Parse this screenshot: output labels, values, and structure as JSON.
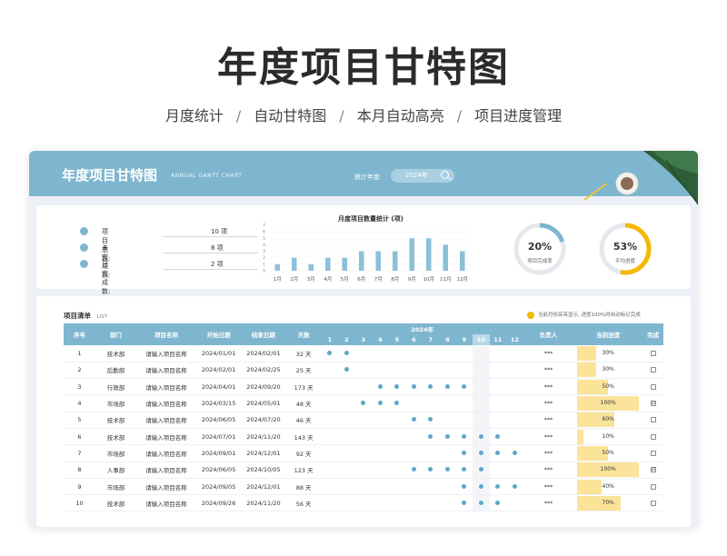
{
  "hero": {
    "title": "年度项目甘特图",
    "subtitles": [
      "月度统计",
      "自动甘特图",
      "本月自动高亮",
      "项目进度管理"
    ],
    "separator": "/"
  },
  "banner": {
    "title": "年度项目甘特图",
    "subtitle_en": "ANNUAL GANTT CHART",
    "year_label": "统计年度",
    "year_value": "2024年"
  },
  "stats": [
    {
      "label": "项目总数:",
      "value": "10 项",
      "icon": "folder-icon"
    },
    {
      "label": "未完成数:",
      "value": "8 项",
      "icon": "clock-icon"
    },
    {
      "label": "已完成数:",
      "value": "2 项",
      "icon": "check-icon"
    }
  ],
  "mini_chart": {
    "title": "月度项目数量统计 (项)"
  },
  "chart_data": {
    "type": "bar",
    "title": "月度项目数量统计 (项)",
    "categories": [
      "1月",
      "2月",
      "3月",
      "4月",
      "5月",
      "6月",
      "7月",
      "8月",
      "9月",
      "10月",
      "11月",
      "12月"
    ],
    "values": [
      1,
      2,
      1,
      2,
      2,
      3,
      3,
      3,
      5,
      5,
      4,
      3
    ],
    "ylim": [
      0,
      7
    ],
    "yticks": [
      "0",
      "1",
      "2",
      "3",
      "4",
      "5",
      "6",
      "7"
    ],
    "color": "#8cc0d8"
  },
  "rings": [
    {
      "pct": "20%",
      "value": 0.2,
      "label": "项目完成率",
      "color": "#7fb6cf"
    },
    {
      "pct": "53%",
      "value": 0.53,
      "label": "平均进度",
      "color": "#f5b800"
    }
  ],
  "list": {
    "title": "项目清单",
    "title_en": "LIST",
    "note": "当前月份高亮显示, 进度100%时自动标记完成",
    "note_color": "#f5b800"
  },
  "table": {
    "headers": [
      "序号",
      "部门",
      "项目名称",
      "开始日期",
      "结束日期",
      "天数"
    ],
    "year_header": "2024年",
    "months": [
      "1",
      "2",
      "3",
      "4",
      "5",
      "6",
      "7",
      "8",
      "9",
      "10",
      "11",
      "12"
    ],
    "current_month": 10,
    "owner_header": "负责人",
    "progress_header": "当前进度",
    "done_header": "完成",
    "rows": [
      {
        "no": "1",
        "dept": "技术部",
        "name": "请输入项目名称",
        "start": "2024/01/01",
        "end": "2024/02/01",
        "days": "32 天",
        "active": [
          1,
          2
        ],
        "owner": "***",
        "progress": "30%",
        "pval": 0.3,
        "done": ""
      },
      {
        "no": "2",
        "dept": "后勤部",
        "name": "请输入项目名称",
        "start": "2024/02/01",
        "end": "2024/02/25",
        "days": "25 天",
        "active": [
          2
        ],
        "owner": "***",
        "progress": "30%",
        "pval": 0.3,
        "done": ""
      },
      {
        "no": "3",
        "dept": "行政部",
        "name": "请输入项目名称",
        "start": "2024/04/01",
        "end": "2024/09/20",
        "days": "173 天",
        "active": [
          4,
          5,
          6,
          7,
          8,
          9
        ],
        "owner": "***",
        "progress": "50%",
        "pval": 0.5,
        "done": ""
      },
      {
        "no": "4",
        "dept": "市场部",
        "name": "请输入项目名称",
        "start": "2024/03/15",
        "end": "2024/05/01",
        "days": "48 天",
        "active": [
          3,
          4,
          5
        ],
        "owner": "***",
        "progress": "100%",
        "pval": 1.0,
        "done": "☑"
      },
      {
        "no": "5",
        "dept": "技术部",
        "name": "请输入项目名称",
        "start": "2024/06/05",
        "end": "2024/07/20",
        "days": "46 天",
        "active": [
          6,
          7
        ],
        "owner": "***",
        "progress": "60%",
        "pval": 0.6,
        "done": ""
      },
      {
        "no": "6",
        "dept": "技术部",
        "name": "请输入项目名称",
        "start": "2024/07/01",
        "end": "2024/11/20",
        "days": "143 天",
        "active": [
          7,
          8,
          9,
          10,
          11
        ],
        "owner": "***",
        "progress": "10%",
        "pval": 0.1,
        "done": ""
      },
      {
        "no": "7",
        "dept": "市场部",
        "name": "请输入项目名称",
        "start": "2024/09/01",
        "end": "2024/12/01",
        "days": "92 天",
        "active": [
          9,
          10,
          11,
          12
        ],
        "owner": "***",
        "progress": "50%",
        "pval": 0.5,
        "done": ""
      },
      {
        "no": "8",
        "dept": "人事部",
        "name": "请输入项目名称",
        "start": "2024/06/05",
        "end": "2024/10/05",
        "days": "123 天",
        "active": [
          6,
          7,
          8,
          9,
          10
        ],
        "owner": "***",
        "progress": "100%",
        "pval": 1.0,
        "done": "☑"
      },
      {
        "no": "9",
        "dept": "市场部",
        "name": "请输入项目名称",
        "start": "2024/09/05",
        "end": "2024/12/01",
        "days": "88 天",
        "active": [
          9,
          10,
          11,
          12
        ],
        "owner": "***",
        "progress": "40%",
        "pval": 0.4,
        "done": ""
      },
      {
        "no": "10",
        "dept": "技术部",
        "name": "请输入项目名称",
        "start": "2024/09/26",
        "end": "2024/11/20",
        "days": "56 天",
        "active": [
          9,
          10,
          11
        ],
        "owner": "***",
        "progress": "70%",
        "pval": 0.7,
        "done": ""
      }
    ]
  }
}
